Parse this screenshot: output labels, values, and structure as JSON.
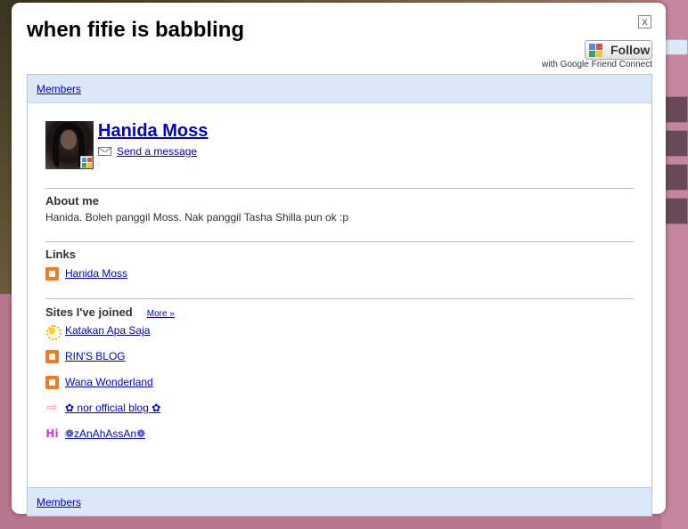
{
  "dialog": {
    "title": "when fifie is babbling",
    "close_label": "x",
    "follow_label": "Follow",
    "gfc_caption": "with Google Friend Connect"
  },
  "members_tab": "Members",
  "profile": {
    "name": "Hanida Moss",
    "send_message": "Send a message"
  },
  "about": {
    "title": "About me",
    "text": "Hanida. Boleh panggil Moss. Nak panggil Tasha Shilla pun ok :p"
  },
  "links": {
    "title": "Links",
    "items": [
      {
        "label": "Hanida Moss",
        "icon": "blogger-icon"
      }
    ]
  },
  "sites": {
    "title": "Sites I've joined",
    "more": "More »",
    "items": [
      {
        "label": "Katakan Apa Saja",
        "icon": "sun-icon"
      },
      {
        "label": "RIN'S BLOG",
        "icon": "blogger-icon"
      },
      {
        "label": "Wana Wonderland",
        "icon": "blogger-icon"
      },
      {
        "label": "✿ nor official blog ✿",
        "icon": "arrow-icon"
      },
      {
        "label": "❁zAnAhAssAn❁",
        "icon": "hi-icon"
      }
    ]
  },
  "colors": {
    "link": "#0000cc",
    "bar": "#dce8f9",
    "blogger": "#f47a20"
  }
}
